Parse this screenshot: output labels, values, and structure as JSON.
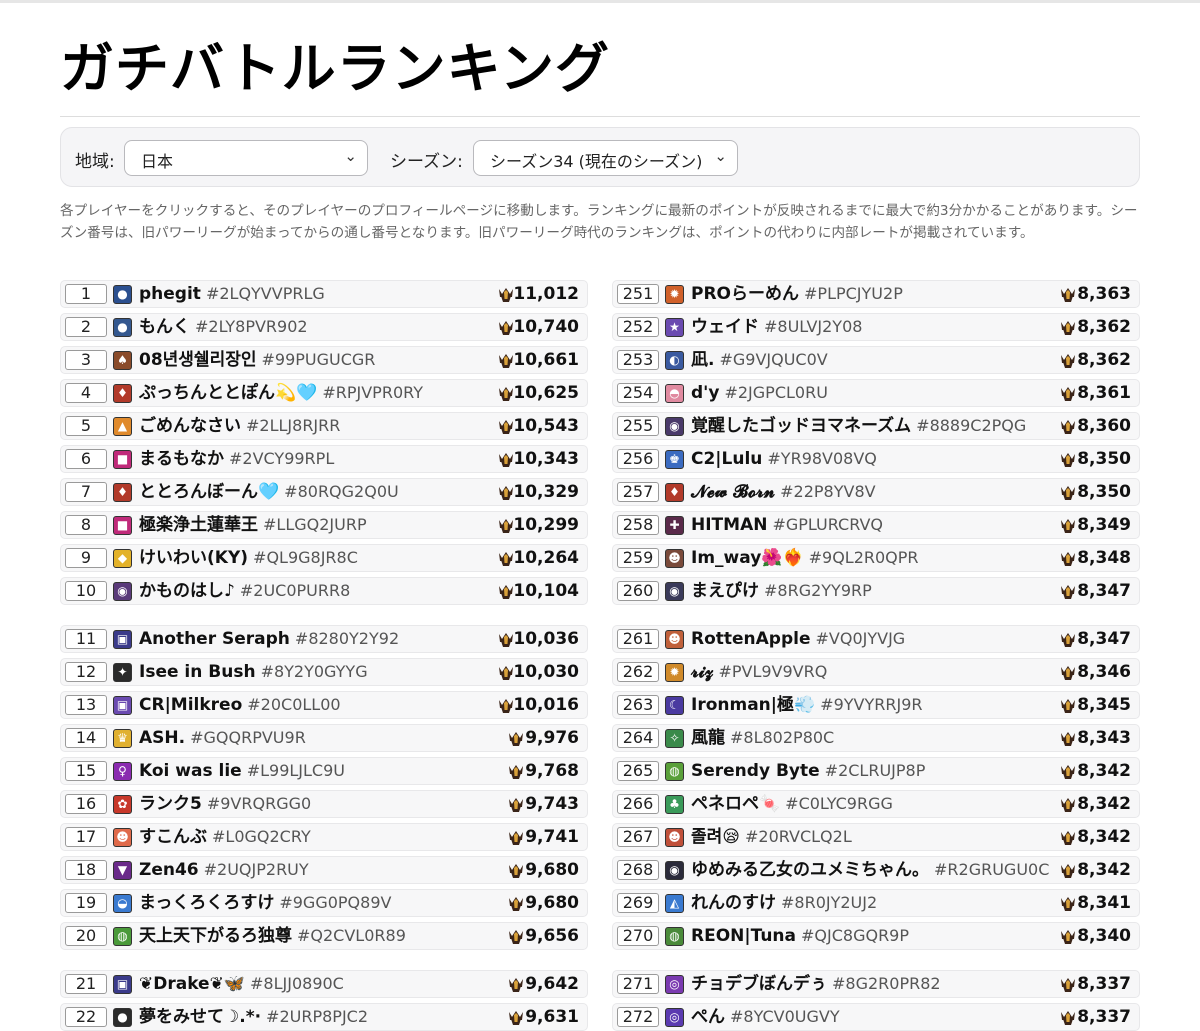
{
  "title": "ガチバトルランキング",
  "filters": {
    "region_label": "地域:",
    "region_value": "日本",
    "season_label": "シーズン:",
    "season_value": "シーズン34 (現在のシーズン)"
  },
  "description": "各プレイヤーをクリックすると、そのプレイヤーのプロフィールページに移動します。ランキングに最新のポイントが反映されるまでに最大で約3分かかることがあります。シーズン番号は、旧パワーリーグが始まってからの通し番号となります。旧パワーリーグ時代のランキングは、ポイントの代わりに内部レートが掲載されています。",
  "colors": {
    "trophy_dark": "#3a2418",
    "trophy_gold": "#d9a13a",
    "row_bg": "#f7f7f8"
  },
  "left": [
    {
      "rank": "1",
      "name": "phegit",
      "tag": "#2LQYVVPRLG",
      "points": "11,012",
      "icon": "panda-icon",
      "bg": "#2b4f8f"
    },
    {
      "rank": "2",
      "name": "もんく",
      "tag": "#2LY8PVR902",
      "points": "10,740",
      "icon": "panda-icon",
      "bg": "#34588f"
    },
    {
      "rank": "3",
      "name": "08년생쉘리장인",
      "tag": "#99PUGUCGR",
      "points": "10,661",
      "icon": "cowboy-icon",
      "bg": "#8a4b2a"
    },
    {
      "rank": "4",
      "name": "ぷっちんととぽん💫🩵",
      "tag": "#RPJVPR0RY",
      "points": "10,625",
      "icon": "hero-icon",
      "bg": "#b23a2a"
    },
    {
      "rank": "5",
      "name": "ごめんなさい",
      "tag": "#2LLJ8RJRR",
      "points": "10,543",
      "icon": "fox-icon",
      "bg": "#e08a2c"
    },
    {
      "rank": "6",
      "name": "まるもなか",
      "tag": "#2VCY99RPL",
      "points": "10,343",
      "icon": "pink-icon",
      "bg": "#c02a7a"
    },
    {
      "rank": "7",
      "name": "ととろんぼーん🩵",
      "tag": "#80RQG2Q0U",
      "points": "10,329",
      "icon": "hero-icon",
      "bg": "#b23a2a"
    },
    {
      "rank": "8",
      "name": "極楽浄土蓮華王",
      "tag": "#LLGQ2JURP",
      "points": "10,299",
      "icon": "pink-icon",
      "bg": "#c02a7a"
    },
    {
      "rank": "9",
      "name": "けいわい(KY)",
      "tag": "#QL9G8JR8C",
      "points": "10,264",
      "icon": "cat-icon",
      "bg": "#e3b22a"
    },
    {
      "rank": "10",
      "name": "かものはし♪",
      "tag": "#2UC0PURR8",
      "points": "10,104",
      "icon": "ghost-icon",
      "bg": "#5a3a7a"
    },
    {
      "rank": "11",
      "name": "Another Seraph",
      "tag": "#8280Y2Y92",
      "points": "10,036",
      "icon": "robot-icon",
      "bg": "#3a3a8a"
    },
    {
      "rank": "12",
      "name": "Isee in Bush",
      "tag": "#8Y2Y0GYYG",
      "points": "10,030",
      "icon": "fire-icon",
      "bg": "#2a2a2a"
    },
    {
      "rank": "13",
      "name": "CR|Milkreo",
      "tag": "#20C0LL00",
      "points": "10,016",
      "icon": "robot-icon",
      "bg": "#6a4ab0"
    },
    {
      "rank": "14",
      "name": "ASH.",
      "tag": "#GQQRPVU9R",
      "points": "9,976",
      "icon": "crown-icon",
      "bg": "#e0b030"
    },
    {
      "rank": "15",
      "name": "Koi was lie",
      "tag": "#L99LJLC9U",
      "points": "9,768",
      "icon": "female-icon",
      "bg": "#8a2ab0"
    },
    {
      "rank": "16",
      "name": "ランク5",
      "tag": "#9VRQRGG0",
      "points": "9,743",
      "icon": "clown-icon",
      "bg": "#c8382a"
    },
    {
      "rank": "17",
      "name": "すこんぶ",
      "tag": "#L0GQ2CRY",
      "points": "9,741",
      "icon": "face-icon",
      "bg": "#e06a4a"
    },
    {
      "rank": "18",
      "name": "Zen46",
      "tag": "#2UQJP2RUY",
      "points": "9,680",
      "icon": "bat-icon",
      "bg": "#6a2a8a"
    },
    {
      "rank": "19",
      "name": "まっくろくろすけ",
      "tag": "#9GG0PQ89V",
      "points": "9,680",
      "icon": "duck-icon",
      "bg": "#3a7ad0"
    },
    {
      "rank": "20",
      "name": "天上天下がるろ独尊",
      "tag": "#Q2CVL0R89",
      "points": "9,656",
      "icon": "frog-icon",
      "bg": "#4a9a3a"
    },
    {
      "rank": "21",
      "name": "❦Drake❦🦋",
      "tag": "#8LJJ0890C",
      "points": "9,642",
      "icon": "robot-icon",
      "bg": "#3a3a8a"
    },
    {
      "rank": "22",
      "name": "夢をみせて☽.*·",
      "tag": "#2URP8PJC2",
      "points": "9,631",
      "icon": "panda-icon",
      "bg": "#2b2b2b"
    }
  ],
  "right": [
    {
      "rank": "251",
      "name": "PROらーめん",
      "tag": "#PLPCJYU2P",
      "points": "8,363",
      "icon": "lion-icon",
      "bg": "#d0602a"
    },
    {
      "rank": "252",
      "name": "ウェイド",
      "tag": "#8ULVJ2Y08",
      "points": "8,362",
      "icon": "star-icon",
      "bg": "#6a4ab0"
    },
    {
      "rank": "253",
      "name": "凪.",
      "tag": "#G9VJQUC0V",
      "points": "8,362",
      "icon": "penguin-icon",
      "bg": "#3a5aa0"
    },
    {
      "rank": "254",
      "name": "d'y",
      "tag": "#2JGPCL0RU",
      "points": "8,361",
      "icon": "pig-icon",
      "bg": "#e08aa0"
    },
    {
      "rank": "255",
      "name": "覚醒したゴッドヨマネーズム",
      "tag": "#8889C2PQG",
      "points": "8,360",
      "icon": "ghost-icon",
      "bg": "#4a3a6a"
    },
    {
      "rank": "256",
      "name": "C2|Lulu",
      "tag": "#YR98V08VQ",
      "points": "8,350",
      "icon": "king-icon",
      "bg": "#3a6ac0"
    },
    {
      "rank": "257",
      "name": "𝓝𝓮𝔀 𝓑𝓸𝓻𝓷",
      "tag": "#22P8YV8V",
      "points": "8,350",
      "icon": "hero-icon",
      "bg": "#b23a2a"
    },
    {
      "rank": "258",
      "name": "HITMAN",
      "tag": "#GPLURCRVQ",
      "points": "8,349",
      "icon": "ninja-icon",
      "bg": "#5a2a4a"
    },
    {
      "rank": "259",
      "name": "Im_way🌺❤️‍🔥",
      "tag": "#9QL2R0QPR",
      "points": "8,348",
      "icon": "face-icon",
      "bg": "#7a4a3a"
    },
    {
      "rank": "260",
      "name": "まえぴけ",
      "tag": "#8RG2YY9RP",
      "points": "8,347",
      "icon": "ghost-icon",
      "bg": "#3a3a5a"
    },
    {
      "rank": "261",
      "name": "RottenApple",
      "tag": "#VQ0JYVJG",
      "points": "8,347",
      "icon": "face-icon",
      "bg": "#c0603a"
    },
    {
      "rank": "262",
      "name": "𝓻𝓲𝔃",
      "tag": "#PVL9V9VRQ",
      "points": "8,346",
      "icon": "lion-icon",
      "bg": "#d08a2a"
    },
    {
      "rank": "263",
      "name": "Ironman|極💨",
      "tag": "#9YVYRRJ9R",
      "points": "8,345",
      "icon": "moon-icon",
      "bg": "#4a3aa0"
    },
    {
      "rank": "264",
      "name": "風龍",
      "tag": "#8L802P80C",
      "points": "8,343",
      "icon": "dragon-icon",
      "bg": "#3a8a4a"
    },
    {
      "rank": "265",
      "name": "Serendy Byte",
      "tag": "#2CLRUJP8P",
      "points": "8,342",
      "icon": "frog-icon",
      "bg": "#5aa03a"
    },
    {
      "rank": "266",
      "name": "ペネロペ🍬",
      "tag": "#C0LYC9RGG",
      "points": "8,342",
      "icon": "leaf-icon",
      "bg": "#3a9a5a"
    },
    {
      "rank": "267",
      "name": "졸려😪",
      "tag": "#20RVCLQ2L",
      "points": "8,342",
      "icon": "face-icon",
      "bg": "#c0503a"
    },
    {
      "rank": "268",
      "name": "ゆめみる乙女のユメミちゃん。",
      "tag": "#R2GRUGU0C",
      "points": "8,342",
      "icon": "ghost-icon",
      "bg": "#2a2a3a"
    },
    {
      "rank": "269",
      "name": "れんのすけ",
      "tag": "#8R0JY2UJ2",
      "points": "8,341",
      "icon": "bird-icon",
      "bg": "#3a7ad0"
    },
    {
      "rank": "270",
      "name": "REON|Tuna",
      "tag": "#QJC8GQR9P",
      "points": "8,340",
      "icon": "frog-icon",
      "bg": "#4a8a3a"
    },
    {
      "rank": "271",
      "name": "チョデブぼんデぅ",
      "tag": "#8G2R0PR82",
      "points": "8,337",
      "icon": "swirl-icon",
      "bg": "#7a3ab0"
    },
    {
      "rank": "272",
      "name": "ぺん",
      "tag": "#8YCV0UGVY",
      "points": "8,337",
      "icon": "swirl-icon",
      "bg": "#5a3ab0"
    }
  ]
}
